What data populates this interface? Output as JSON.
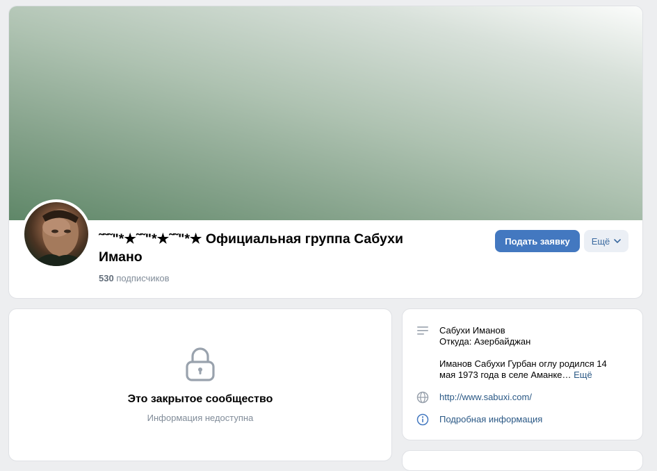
{
  "group": {
    "title": "˜˜˜\"*★˜˜\"*★˜˜\"*★ Официальная группа Сабухи Имано",
    "subscribers_count": "530",
    "subscribers_label": "подписчиков",
    "apply_button": "Подать заявку",
    "more_button": "Ещё"
  },
  "closed": {
    "title": "Это закрытое сообщество",
    "subtitle": "Информация недоступна"
  },
  "info": {
    "name": "Сабухи Иманов",
    "from": "Откуда: Азербайджан",
    "bio": "Иманов Сабухи Гурбан оглу родился 14 мая 1973 года в селе Аманке…",
    "bio_more": "Ещё",
    "website": "http://www.sabuxi.com/",
    "details": "Подробная информация"
  },
  "colors": {
    "accent": "#4378c0",
    "link": "#2a5885",
    "muted": "#818c99",
    "background": "#edeef0"
  },
  "icons": [
    "lines-icon",
    "globe-icon",
    "info-icon",
    "lock-icon",
    "chevron-down-icon"
  ]
}
